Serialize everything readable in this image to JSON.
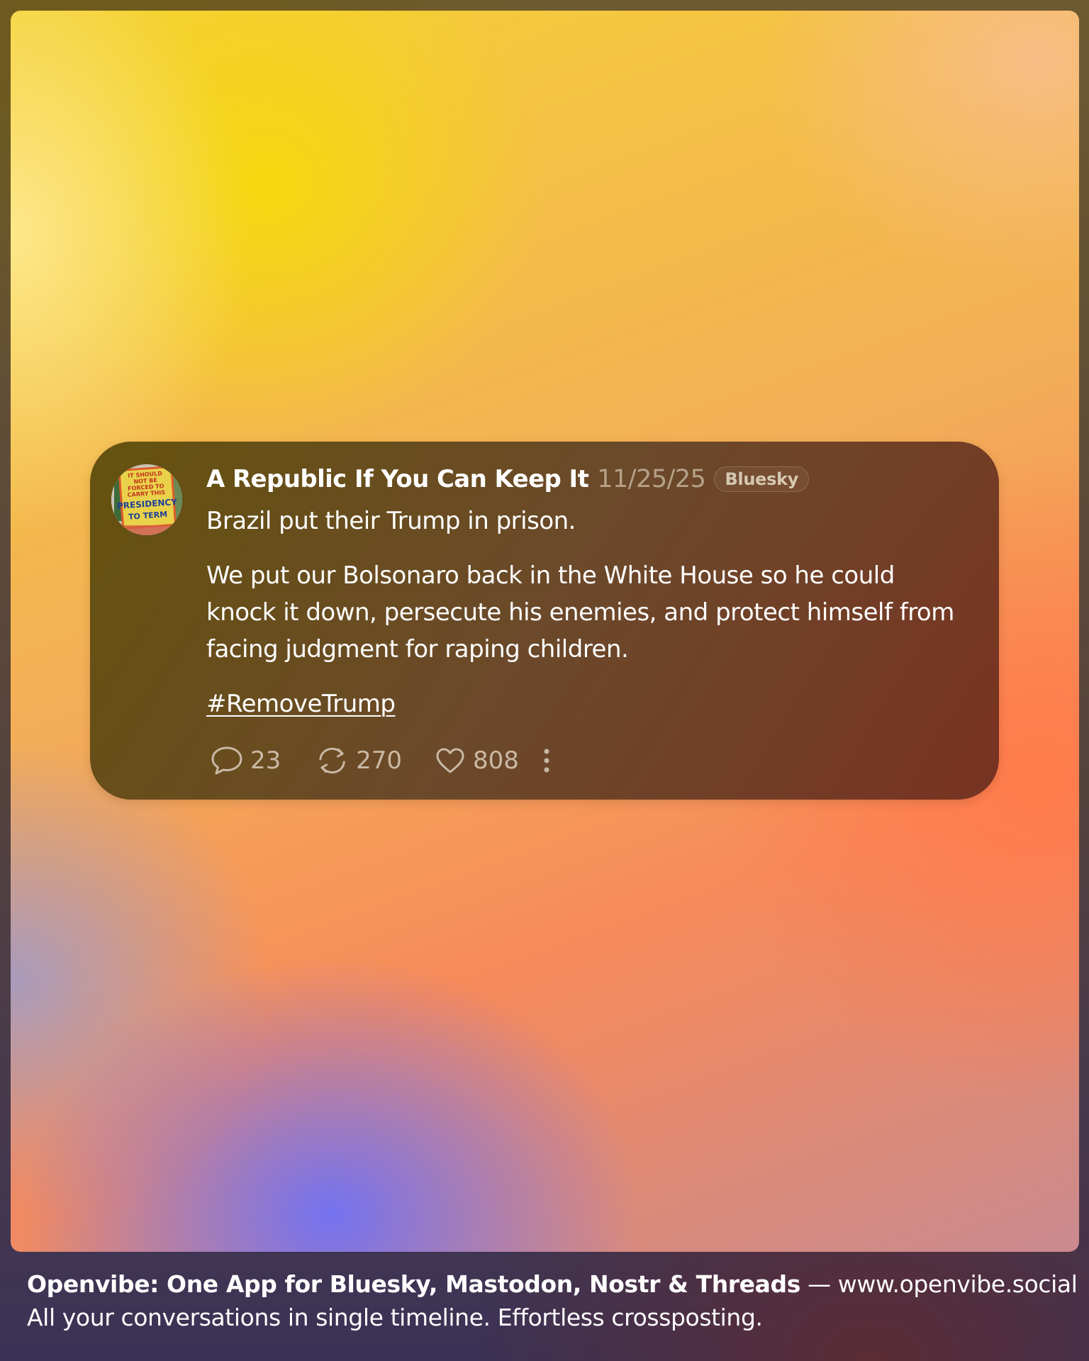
{
  "post": {
    "author": "A Republic If You Can Keep It",
    "date": "11/25/25",
    "network": "Bluesky",
    "avatar_sign_text": [
      "IT SHOULD",
      "NOT BE",
      "FORCED TO",
      "CARRY THIS",
      "PRESIDENCY",
      "TO TERM"
    ],
    "paragraphs": [
      "Brazil put their Trump in prison.",
      "We put our Bolsonaro back in the White House so he could knock it down, persecute his enemies, and protect himself from facing judgment for raping children."
    ],
    "hashtag": "#RemoveTrump",
    "stats": {
      "replies": "23",
      "reposts": "270",
      "likes": "808"
    },
    "icons": {
      "reply": "speech-bubble-icon",
      "repost": "repost-arrows-icon",
      "like": "heart-icon",
      "more": "vertical-ellipsis-icon"
    }
  },
  "footer": {
    "headline": "Openvibe: One App for Bluesky, Mastodon, Nostr & Threads",
    "separator": " — ",
    "url": "www.openvibe.social",
    "tagline": "All your conversations in single timeline. Effortless crossposting."
  },
  "colors": {
    "card": "#5f4e0c",
    "muted_text": "#b5a189",
    "gradient_yellow": "#f5d80e",
    "gradient_orange": "#ff7b4b",
    "gradient_blue": "#7472f0"
  }
}
